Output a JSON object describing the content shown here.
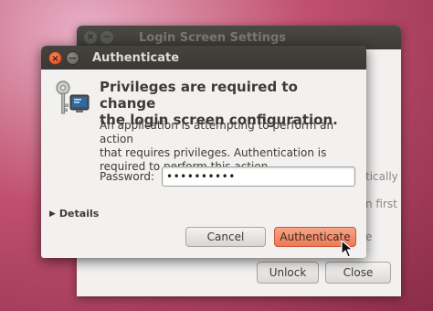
{
  "background_window": {
    "title": "Login Screen Settings",
    "close_glyph": "×",
    "minimize_glyph": "−",
    "fragment_1": "tically",
    "fragment_2": "n first",
    "fragment_3": "e",
    "unlock_label": "Unlock",
    "close_label": "Close"
  },
  "dialog": {
    "title": "Authenticate",
    "close_glyph": "×",
    "minimize_glyph": "−",
    "heading_line1": "Privileges are required to change",
    "heading_line2": "the login screen configuration.",
    "description_line1": "An application is attempting to perform an action",
    "description_line2": "that requires privileges. Authentication is",
    "description_line3": "required to perform this action.",
    "password_label": "Password:",
    "password_value": "••••••••••",
    "details_label": "Details",
    "details_glyph": "▶",
    "cancel_label": "Cancel",
    "authenticate_label": "Authenticate"
  },
  "icons": {
    "dialog_icon": "keys-icon",
    "pointer": "mouse-cursor-icon"
  },
  "colors": {
    "accent_button": "#ec7a56",
    "titlebar": "#3c3b37",
    "close_button": "#d9431d"
  }
}
